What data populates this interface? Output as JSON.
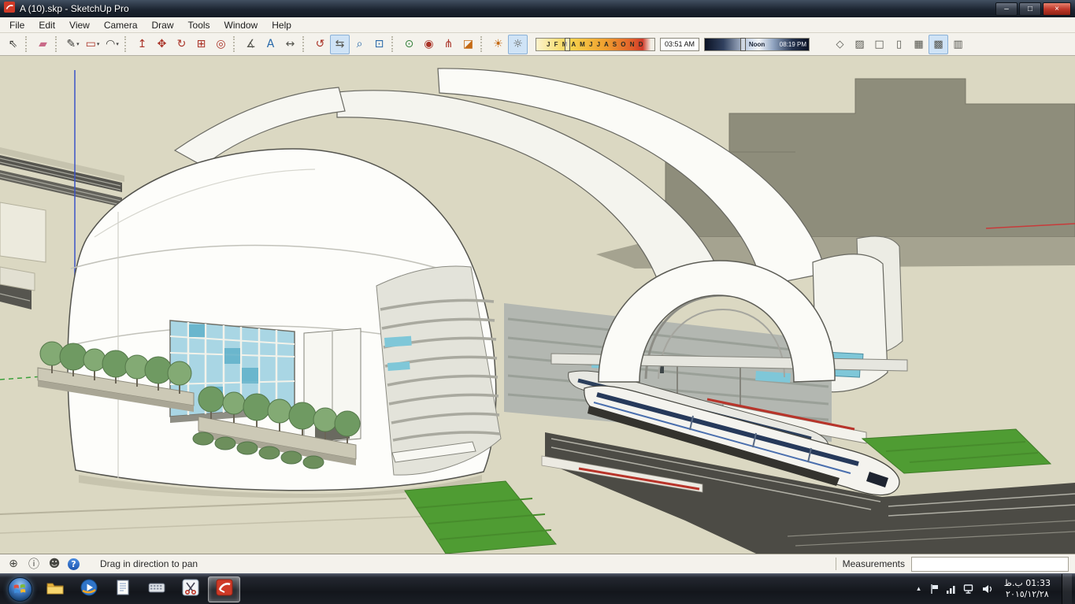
{
  "window": {
    "title": "A (10).skp - SketchUp Pro",
    "controls": {
      "minimize": "–",
      "maximize": "□",
      "close": "×"
    }
  },
  "menu": {
    "items": [
      "File",
      "Edit",
      "View",
      "Camera",
      "Draw",
      "Tools",
      "Window",
      "Help"
    ]
  },
  "toolbar": {
    "dropdown_glyph": "▾",
    "tools": [
      {
        "name": "select",
        "glyph": "⇖"
      },
      {
        "name": "eraser",
        "glyph": "▰"
      },
      {
        "name": "line",
        "glyph": "✎",
        "dropdown": true
      },
      {
        "name": "shapes",
        "glyph": "▭",
        "dropdown": true
      },
      {
        "name": "arcs",
        "glyph": "◠",
        "dropdown": true
      },
      {
        "name": "push-pull",
        "glyph": "↥"
      },
      {
        "name": "move",
        "glyph": "✥"
      },
      {
        "name": "rotate",
        "glyph": "↻"
      },
      {
        "name": "scale",
        "glyph": "⊞"
      },
      {
        "name": "offset",
        "glyph": "◎"
      },
      {
        "name": "tape-measure",
        "glyph": "∡"
      },
      {
        "name": "text",
        "glyph": "A"
      },
      {
        "name": "dimension",
        "glyph": "↔"
      },
      {
        "name": "orbit",
        "glyph": "↺"
      },
      {
        "name": "pan",
        "glyph": "⇆",
        "pressed": true
      },
      {
        "name": "zoom",
        "glyph": "⌕"
      },
      {
        "name": "zoom-extents",
        "glyph": "⊡"
      },
      {
        "name": "position-camera",
        "glyph": "⊙"
      },
      {
        "name": "look-around",
        "glyph": "◉"
      },
      {
        "name": "walk",
        "glyph": "⋔"
      },
      {
        "name": "section-plane",
        "glyph": "◪"
      },
      {
        "name": "toggle-shadows",
        "glyph": "☀"
      },
      {
        "name": "shadow-settings",
        "glyph": "☼",
        "pressed": true
      }
    ],
    "shadow_controls": {
      "months_label": "J F M A M J J A S O N D",
      "time_value": "03:51 AM",
      "noon_label": "Noon",
      "end_time_label": "08:19 PM"
    },
    "face_styles": [
      {
        "name": "x-ray",
        "glyph": "◇"
      },
      {
        "name": "back-edges",
        "glyph": "▨"
      },
      {
        "name": "wireframe",
        "glyph": "□"
      },
      {
        "name": "hidden-line",
        "glyph": "▯"
      },
      {
        "name": "shaded",
        "glyph": "▦"
      },
      {
        "name": "shaded-with-textures",
        "glyph": "▩",
        "pressed": true
      },
      {
        "name": "monochrome",
        "glyph": "▥"
      }
    ]
  },
  "statusbar": {
    "icons": [
      {
        "name": "geolocation",
        "glyph": "⊕"
      },
      {
        "name": "credits",
        "glyph": "ⓘ"
      },
      {
        "name": "claim-credit",
        "glyph": "☻"
      },
      {
        "name": "help",
        "glyph": "?"
      }
    ],
    "hint": "Drag in direction to pan",
    "measurements_label": "Measurements",
    "measurements_value": ""
  },
  "taskbar": {
    "apps": [
      {
        "name": "windows-explorer"
      },
      {
        "name": "media-player"
      },
      {
        "name": "notepad"
      },
      {
        "name": "on-screen-keyboard"
      },
      {
        "name": "snipping-tool"
      },
      {
        "name": "sketchup",
        "active": true
      }
    ],
    "tray_expand_glyph": "▴",
    "clock": {
      "time": "01:33 ب.ظ",
      "date": "٢٠١٥/١٢/٢٨"
    }
  },
  "palette": {
    "ground": "#dbd8c2",
    "shell_white": "#fbfbf7",
    "glass_cyan": "#7fc7d8",
    "grass_green": "#4f9c33",
    "accent_red": "#b8342a",
    "axis_red": "#c83a3a",
    "axis_blue": "#3a52c8",
    "axis_green": "#3aa03a",
    "mountain_gray": "#8e8d7b",
    "taskbar_dark": "#13161c",
    "titlebar_navy": "#1c2531"
  }
}
